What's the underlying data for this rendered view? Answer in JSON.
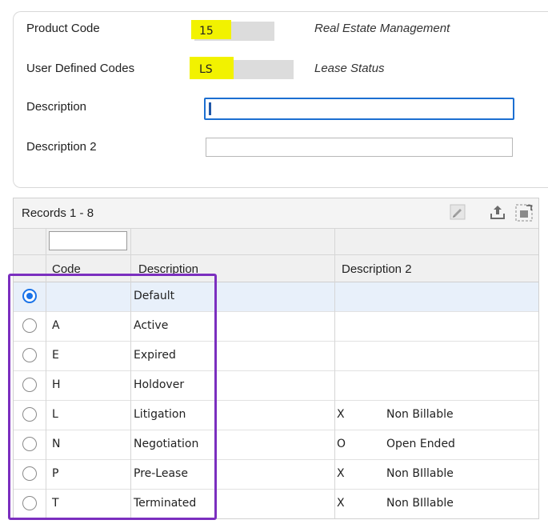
{
  "form": {
    "product_code_label": "Product Code",
    "product_code_value": "15",
    "product_code_desc": "Real Estate Management",
    "udc_label": "User Defined Codes",
    "udc_value": "LS",
    "udc_desc": "Lease Status",
    "description_label": "Description",
    "description_value": "",
    "description2_label": "Description 2",
    "description2_value": ""
  },
  "grid": {
    "records_label": "Records 1 - 8",
    "toolbar_icons": [
      "edit-grid-icon",
      "export-icon",
      "grid-format-icon"
    ],
    "columns": {
      "code": "Code",
      "description": "Description",
      "description2": "Description 2"
    },
    "rows": [
      {
        "code": "",
        "description": "Default",
        "d2_flag": "",
        "d2_text": "",
        "selected": true
      },
      {
        "code": "A",
        "description": "Active",
        "d2_flag": "",
        "d2_text": "",
        "selected": false
      },
      {
        "code": "E",
        "description": "Expired",
        "d2_flag": "",
        "d2_text": "",
        "selected": false
      },
      {
        "code": "H",
        "description": "Holdover",
        "d2_flag": "",
        "d2_text": "",
        "selected": false
      },
      {
        "code": "L",
        "description": "Litigation",
        "d2_flag": "X",
        "d2_text": "Non Billable",
        "selected": false
      },
      {
        "code": "N",
        "description": "Negotiation",
        "d2_flag": "O",
        "d2_text": "Open Ended",
        "selected": false
      },
      {
        "code": "P",
        "description": "Pre-Lease",
        "d2_flag": "X",
        "d2_text": "Non BIllable",
        "selected": false
      },
      {
        "code": "T",
        "description": "Terminated",
        "d2_flag": "X",
        "d2_text": "Non BIllable",
        "selected": false
      }
    ]
  },
  "colors": {
    "highlight": "#f2f200",
    "annotation_box": "#7b2fbf",
    "radio_selected": "#1a73e8",
    "focus_border": "#1c6fd1",
    "selected_row_bg": "#e8f0fa"
  }
}
